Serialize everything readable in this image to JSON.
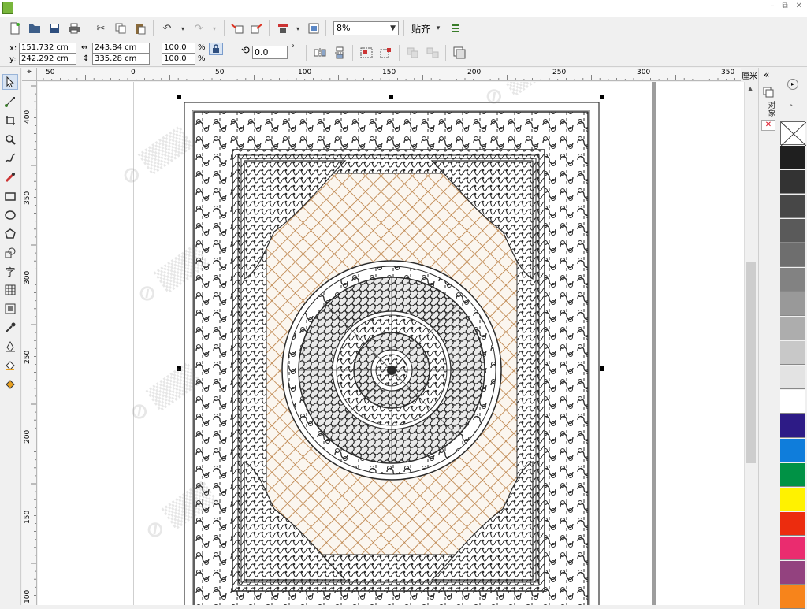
{
  "window": {
    "minimize": "–",
    "restore": "⧉",
    "close": "✕"
  },
  "toolbar": {
    "zoom_value": "8%",
    "snap_label": "贴齐",
    "snap_arrow": "▾"
  },
  "properties": {
    "x_label": "x:",
    "y_label": "y:",
    "x_value": "151.732 cm",
    "y_value": "242.292 cm",
    "width_value": "243.84 cm",
    "height_value": "335.28 cm",
    "scale_x": "100.0",
    "scale_y": "100.0",
    "percent": "%",
    "rotation_value": "0.0",
    "degree": "°"
  },
  "ruler": {
    "unit": "厘米",
    "h_ticks": [
      "50",
      "0",
      "50",
      "100",
      "150",
      "200",
      "250",
      "300",
      "350"
    ],
    "v_ticks": [
      "400",
      "350",
      "300",
      "250",
      "200",
      "150",
      "100"
    ]
  },
  "docker": {
    "collapse": "«",
    "tab_label": "对象"
  },
  "palette": {
    "colors": [
      "#ffffff",
      "#1f1f1f",
      "#333333",
      "#474747",
      "#5a5a5a",
      "#6e6e6e",
      "#828282",
      "#999999",
      "#adadad",
      "#c8c8c8",
      "#e3e3e3",
      "#ffffff",
      "#2d1b86",
      "#0f7ddb",
      "#009245",
      "#fff200",
      "#ec2c0e",
      "#ea2c6f",
      "#93427f",
      "#f7841b"
    ]
  },
  "colors": {
    "border_ink": "#2b2b2b",
    "lattice": "#b7793b",
    "field_bg": "#fbf6ef"
  }
}
